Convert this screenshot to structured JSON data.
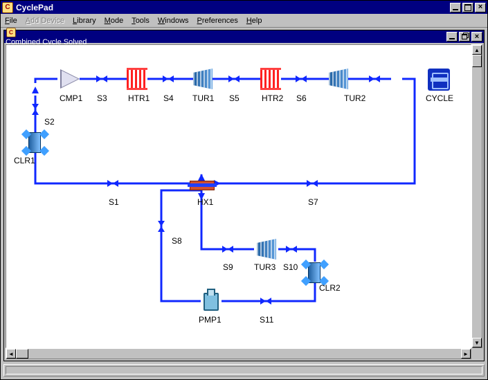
{
  "app": {
    "title": "CyclePad"
  },
  "menu": {
    "file": "File",
    "add_device": "Add Device",
    "library": "Library",
    "mode": "Mode",
    "tools": "Tools",
    "windows": "Windows",
    "preferences": "Preferences",
    "help": "Help"
  },
  "doc": {
    "title": "Combined Cycle Solved"
  },
  "components": {
    "CMP1": "CMP1",
    "HTR1": "HTR1",
    "TUR1": "TUR1",
    "HTR2": "HTR2",
    "TUR2": "TUR2",
    "CYCLE": "CYCLE",
    "CLR1": "CLR1",
    "HX1": "HX1",
    "TUR3": "TUR3",
    "CLR2": "CLR2",
    "PMP1": "PMP1"
  },
  "streams": {
    "S1": "S1",
    "S2": "S2",
    "S3": "S3",
    "S4": "S4",
    "S5": "S5",
    "S6": "S6",
    "S7": "S7",
    "S8": "S8",
    "S9": "S9",
    "S10": "S10",
    "S11": "S11"
  },
  "colors": {
    "stream": "#1028ff",
    "titlebar": "#000080",
    "chrome": "#c0c0c0"
  }
}
